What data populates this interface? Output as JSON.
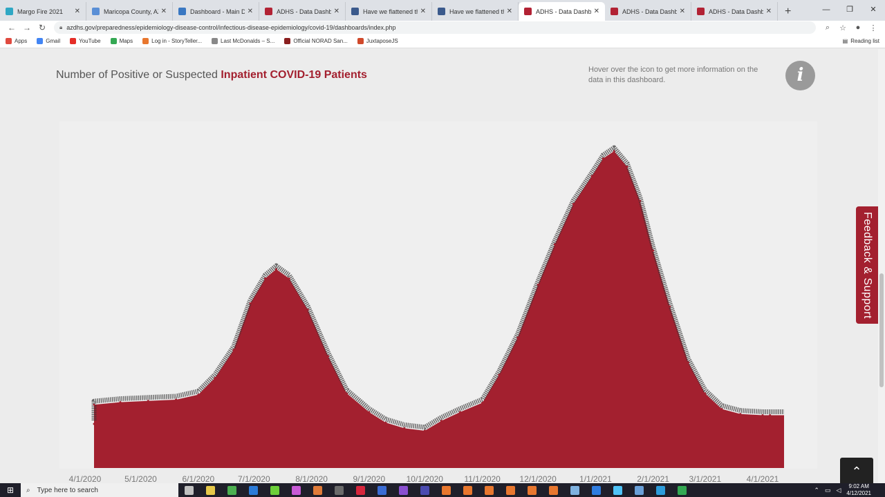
{
  "browser": {
    "tabs": [
      {
        "title": "Margo Fire 2021",
        "color": "#2ea7c4",
        "active": false
      },
      {
        "title": "Maricopa County, AZ |",
        "color": "#5a8fd6",
        "active": false
      },
      {
        "title": "Dashboard - Main Dash",
        "color": "#3a78c2",
        "active": false
      },
      {
        "title": "ADHS - Data Dashboar",
        "color": "#b22234",
        "active": false
      },
      {
        "title": "Have we flattened the",
        "color": "#3b5a8c",
        "active": false
      },
      {
        "title": "Have we flattened the",
        "color": "#3b5a8c",
        "active": false
      },
      {
        "title": "ADHS - Data Dashboar",
        "color": "#b22234",
        "active": true
      },
      {
        "title": "ADHS - Data Dashboar",
        "color": "#b22234",
        "active": false
      },
      {
        "title": "ADHS - Data Dashboar",
        "color": "#b22234",
        "active": false
      }
    ],
    "new_tab": "+",
    "url": "azdhs.gov/preparedness/epidemiology-disease-control/infectious-disease-epidemiology/covid-19/dashboards/index.php",
    "bookmarks": [
      {
        "label": "Apps",
        "color": "#e04a3f"
      },
      {
        "label": "Gmail",
        "color": "#4285f4"
      },
      {
        "label": "YouTube",
        "color": "#e52d27"
      },
      {
        "label": "Maps",
        "color": "#34a853"
      },
      {
        "label": "Log in - StoryTeller...",
        "color": "#e8772e"
      },
      {
        "label": "Last McDonalds – S...",
        "color": "#888888"
      },
      {
        "label": "Official NORAD San...",
        "color": "#8a1f1f"
      },
      {
        "label": "JuxtaposeJS",
        "color": "#d0492b"
      }
    ],
    "reading_list": "Reading list"
  },
  "dashboard": {
    "title_prefix": "Number of Positive or Suspected ",
    "title_highlight": "Inpatient COVID-19 Patients",
    "hover_note": "Hover over the icon to get more information on the data in this dashboard.",
    "info_icon_glyph": "i",
    "feedback_label": "Feedback & Support",
    "scroll_top_glyph": "⌃",
    "accent_color": "#a3202f"
  },
  "chart_data": {
    "type": "area",
    "title": "Number of Positive or Suspected Inpatient COVID-19 Patients",
    "color": "#a3202f",
    "x_tick_labels": [
      "4/1/2020",
      "5/1/2020",
      "6/1/2020",
      "7/1/2020",
      "8/1/2020",
      "9/1/2020",
      "10/1/2020",
      "11/1/2020",
      "12/1/2020",
      "1/1/2021",
      "2/1/2021",
      "3/1/2021",
      "4/1/2021"
    ],
    "x": [
      "3/30/2020",
      "4/5/2020",
      "4/20/2020",
      "5/5/2020",
      "5/20/2020",
      "6/1/2020",
      "6/10/2020",
      "6/20/2020",
      "6/29/2020",
      "7/7/2020",
      "7/13/2020",
      "7/20/2020",
      "7/30/2020",
      "8/10/2020",
      "8/20/2020",
      "9/1/2020",
      "9/10/2020",
      "9/20/2020",
      "10/1/2020",
      "10/10/2020",
      "10/20/2020",
      "11/1/2020",
      "11/10/2020",
      "11/20/2020",
      "12/1/2020",
      "12/10/2020",
      "12/20/2020",
      "12/30/2020",
      "1/5/2021",
      "1/11/2021",
      "1/18/2021",
      "1/25/2021",
      "2/1/2021",
      "2/10/2021",
      "2/20/2021",
      "3/1/2021",
      "3/10/2021",
      "3/20/2021",
      "4/1/2021",
      "4/5/2021"
    ],
    "y": [
      710,
      1020,
      1060,
      1080,
      1100,
      1180,
      1450,
      1900,
      2650,
      3050,
      3200,
      3050,
      2550,
      1800,
      1200,
      900,
      730,
      640,
      600,
      760,
      900,
      1050,
      1500,
      2100,
      2950,
      3600,
      4250,
      4700,
      4980,
      5100,
      4850,
      4300,
      3500,
      2600,
      1700,
      1200,
      950,
      870,
      850,
      850
    ],
    "ylim": [
      0,
      5300
    ],
    "grid": false,
    "legend": "none"
  },
  "taskbar": {
    "search_placeholder": "Type here to search",
    "apps": [
      "#c0c0c0",
      "#e6c84a",
      "#4caf50",
      "#2b7bd8",
      "#6ccf3a",
      "#c85ad6",
      "#e07b39",
      "#6b6b6b",
      "#d7263d",
      "#3b6cd4",
      "#8a4fd0",
      "#4b4bb0",
      "#e8772e",
      "#e8772e",
      "#e8772e",
      "#e8772e",
      "#e8772e",
      "#e8772e",
      "#7fb2e0",
      "#2f7de0",
      "#4fc3f7",
      "#6aa0d8",
      "#2d9cdb",
      "#34a853"
    ],
    "time": "9:02 AM",
    "date": "4/12/2021"
  }
}
